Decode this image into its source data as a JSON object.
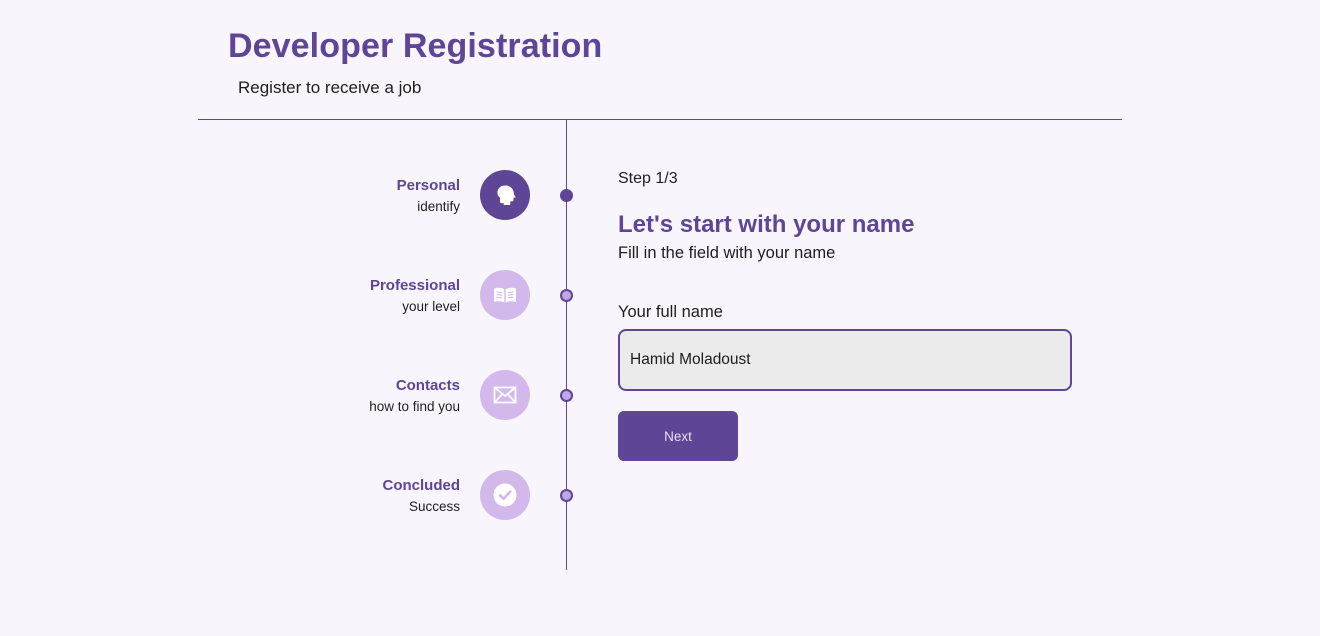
{
  "header": {
    "title": "Developer Registration",
    "subtitle": "Register to receive a job"
  },
  "steps": [
    {
      "title": "Personal",
      "subtitle": "identify",
      "icon": "person-head-icon",
      "active": true
    },
    {
      "title": "Professional",
      "subtitle": "your level",
      "icon": "open-book-icon",
      "active": false
    },
    {
      "title": "Contacts",
      "subtitle": "how to find you",
      "icon": "envelope-icon",
      "active": false
    },
    {
      "title": "Concluded",
      "subtitle": "Success",
      "icon": "check-circle-icon",
      "active": false
    }
  ],
  "form": {
    "step_counter": "Step 1/3",
    "heading": "Let's start with your name",
    "description": "Fill in the field with your name",
    "field_label": "Your full name",
    "name_value": "Hamid Moladoust",
    "next_label": "Next"
  },
  "colors": {
    "accent": "#5e4596",
    "step_inactive": "#d3b8ec",
    "background": "#f8f5fc",
    "input_bg": "#ebebeb"
  }
}
